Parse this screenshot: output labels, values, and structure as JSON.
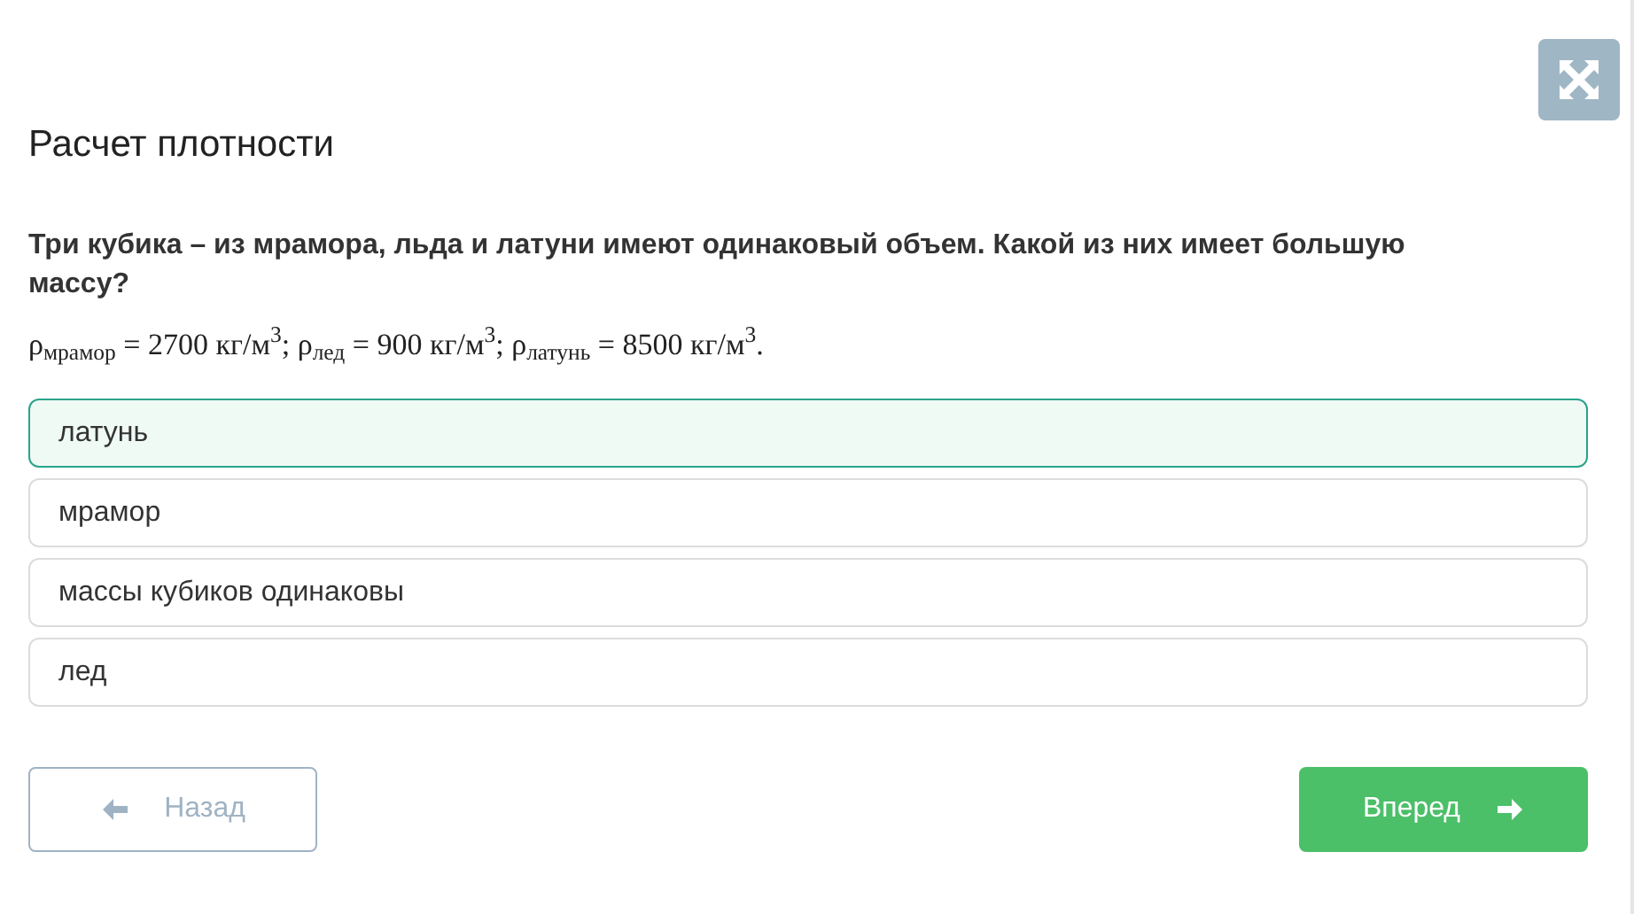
{
  "title": "Расчет плотности",
  "question": "Три кубика – из мрамора, льда и латуни имеют одинаковый объем. Какой из них имеет большую массу?",
  "formula": "ρ$_{мрамор}$ = 2700 кг/м$^{3}$; ρ$_{лед}$ = 900 кг/м$^{3}$; ρ$_{латунь}$ = 8500 кг/м$^{3}$.",
  "options": [
    {
      "label": "латунь",
      "selected": true
    },
    {
      "label": "мрамор",
      "selected": false
    },
    {
      "label": "массы кубиков одинаковы",
      "selected": false
    },
    {
      "label": "лед",
      "selected": false
    }
  ],
  "back_button": {
    "label": "Назад",
    "disabled": true
  },
  "next_button": {
    "label": "Вперед",
    "disabled": false
  }
}
